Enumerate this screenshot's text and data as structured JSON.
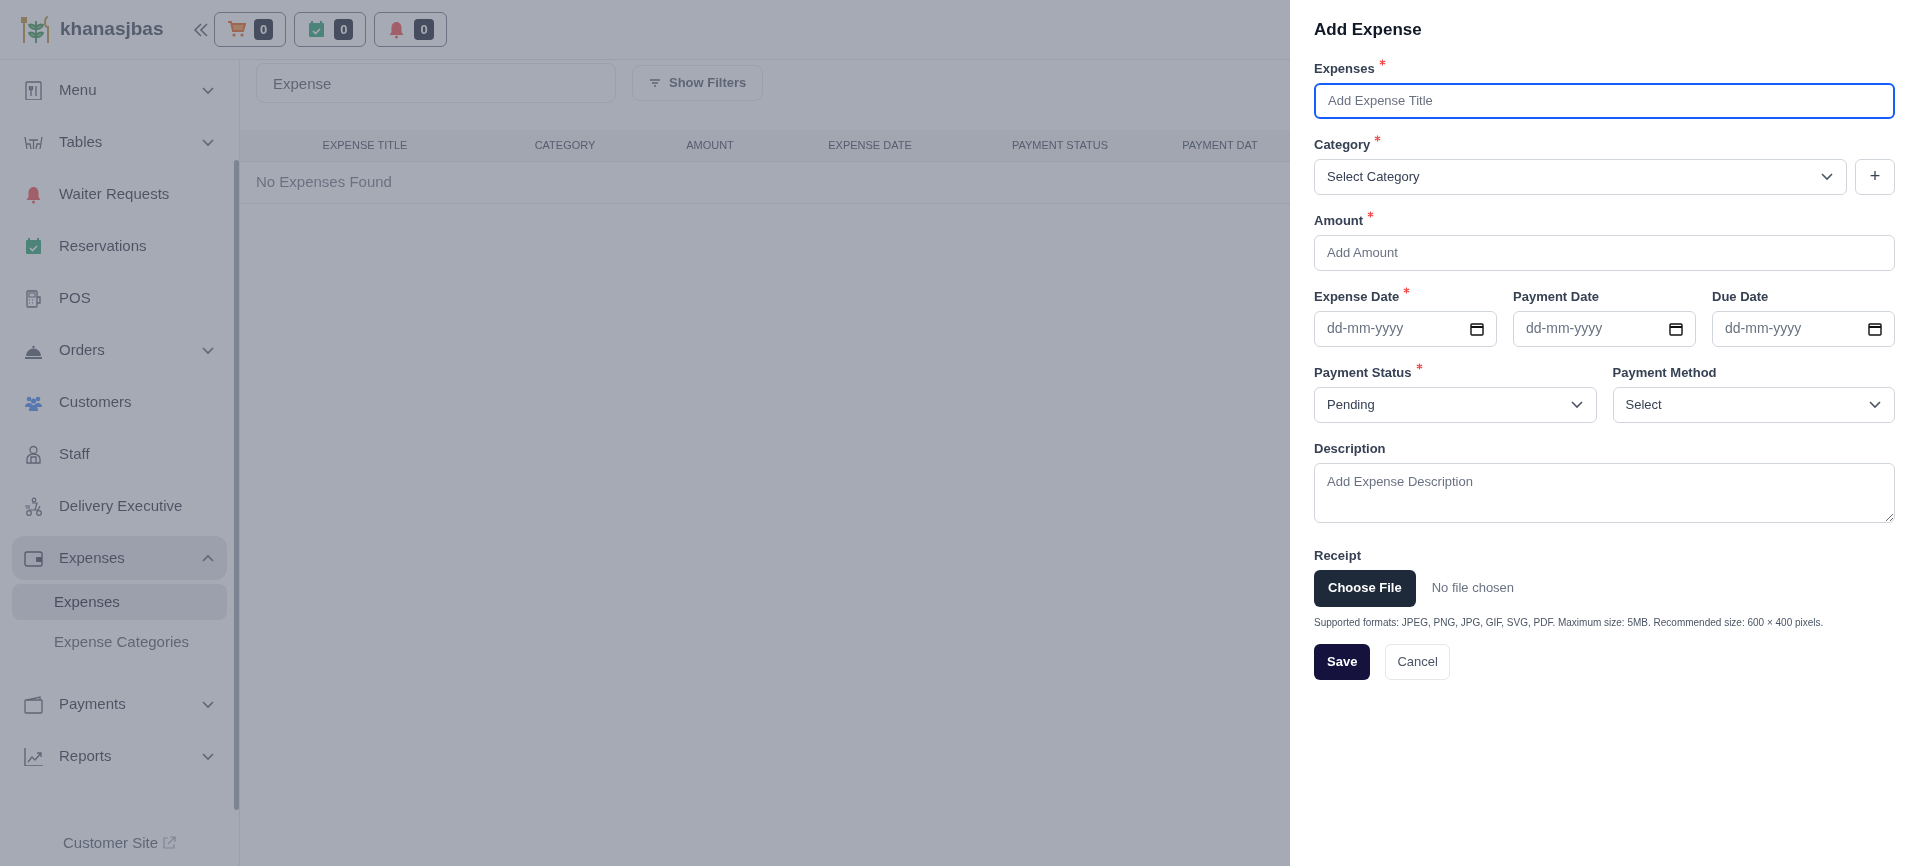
{
  "header": {
    "brand": "khanasjbas",
    "badges": [
      {
        "kind": "cart",
        "count": "0"
      },
      {
        "kind": "calendar",
        "count": "0"
      },
      {
        "kind": "bell",
        "count": "0"
      }
    ]
  },
  "sidebar": {
    "items": [
      {
        "kind": "menu",
        "label": "Menu",
        "expanded": false
      },
      {
        "kind": "tables",
        "label": "Tables",
        "expanded": false
      },
      {
        "kind": "bell",
        "label": "Waiter Requests"
      },
      {
        "kind": "calendar",
        "label": "Reservations"
      },
      {
        "kind": "pos",
        "label": "POS"
      },
      {
        "kind": "cloche",
        "label": "Orders",
        "expanded": false
      },
      {
        "kind": "people",
        "label": "Customers"
      },
      {
        "kind": "person",
        "label": "Staff"
      },
      {
        "kind": "delivery",
        "label": "Delivery Executive"
      },
      {
        "kind": "wallet",
        "label": "Expenses",
        "expanded": true,
        "children": [
          {
            "label": "Expenses",
            "selected": true
          },
          {
            "label": "Expense Categories",
            "selected": false
          }
        ]
      },
      {
        "kind": "folder",
        "label": "Payments",
        "expanded": false
      },
      {
        "kind": "chart",
        "label": "Reports",
        "expanded": false
      }
    ],
    "footer_link": "Customer Site"
  },
  "main": {
    "search": {
      "placeholder": "Expense"
    },
    "filter_button": "Show Filters",
    "table": {
      "columns": [
        "EXPENSE TITLE",
        "CATEGORY",
        "AMOUNT",
        "EXPENSE DATE",
        "PAYMENT STATUS",
        "PAYMENT DAT"
      ],
      "empty_message": "No Expenses Found"
    }
  },
  "drawer": {
    "title": "Add Expense",
    "expense_title": {
      "label": "Expenses",
      "required": true,
      "placeholder": "Add Expense Title"
    },
    "category": {
      "label": "Category",
      "required": true,
      "value": "Select Category",
      "add_button": "+"
    },
    "amount": {
      "label": "Amount",
      "required": true,
      "placeholder": "Add Amount"
    },
    "dates": [
      {
        "label": "Expense Date",
        "required": true,
        "placeholder": "dd-mm-yyyy"
      },
      {
        "label": "Payment Date",
        "required": false,
        "placeholder": "dd-mm-yyyy"
      },
      {
        "label": "Due Date",
        "required": false,
        "placeholder": "dd-mm-yyyy"
      }
    ],
    "selects": [
      {
        "label": "Payment Status",
        "required": true,
        "value": "Pending"
      },
      {
        "label": "Payment Method",
        "required": false,
        "value": "Select"
      }
    ],
    "description": {
      "label": "Description",
      "placeholder": "Add Expense Description"
    },
    "receipt": {
      "label": "Receipt",
      "button": "Choose File",
      "status": "No file chosen",
      "hint": "Supported formats: JPEG, PNG, JPG, GIF, SVG, PDF. Maximum size: 5MB. Recommended size: 600 × 400 pixels."
    },
    "buttons": {
      "save": "Save",
      "cancel": "Cancel"
    }
  }
}
